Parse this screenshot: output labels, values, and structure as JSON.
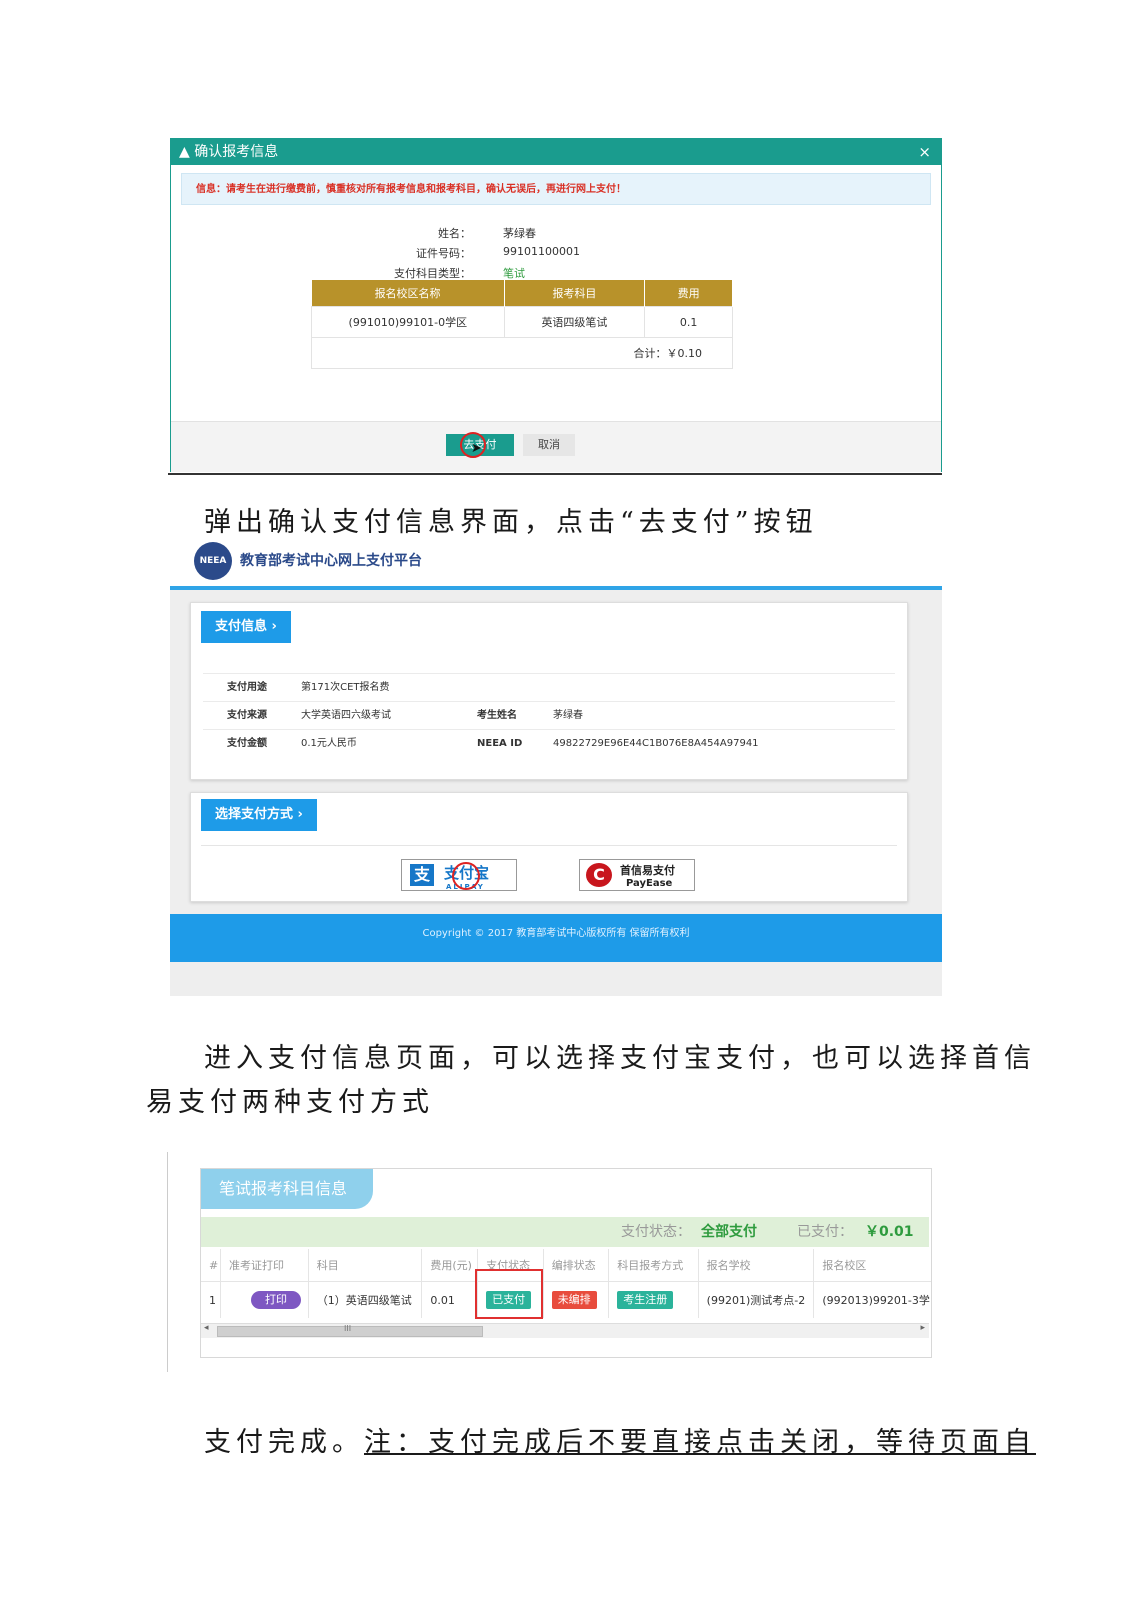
{
  "dialog": {
    "title": "确认报考信息",
    "close_icon": "×",
    "notice": "信息：请考生在进行缴费前，慎重核对所有报考信息和报考科目，确认无误后，再进行网上支付！",
    "name_label": "姓名：",
    "name_value": "茅绿春",
    "id_label": "证件号码：",
    "id_value": "99101100001",
    "type_label": "支付科目类型：",
    "type_value": "笔试",
    "table": {
      "headers": [
        "报名校区名称",
        "报考科目",
        "费用"
      ],
      "row": [
        "(991010)99101-0学区",
        "英语四级笔试",
        "0.1"
      ],
      "total": "合计：￥0.10"
    },
    "pay_button": "去支付",
    "cancel_button": "取消"
  },
  "caption1": "弹出确认支付信息界面，点击“去支付”按钮",
  "platform": {
    "logo_text": "NEEA",
    "site_name": "教育部考试中心网上支付平台",
    "section1": "支付信息 ›",
    "rows": [
      {
        "k1": "支付用途",
        "v1": "第171次CET报名费",
        "k2": "",
        "v2": ""
      },
      {
        "k1": "支付来源",
        "v1": "大学英语四六级考试",
        "k2": "考生姓名",
        "v2": "茅绿春"
      },
      {
        "k1": "支付金额",
        "v1": "0.1元人民币",
        "k2": "NEEA ID",
        "v2": "49822729E96E44C1B076E8A454A97941"
      }
    ],
    "section2": "选择支付方式 ›",
    "alipay_icon": "支",
    "alipay": "支付宝",
    "alipay_sub": "ALIPAY",
    "payease_icon": "C",
    "payease": "首信易支付",
    "payease_sub": "PayEase",
    "copyright": "Copyright © 2017 教育部考试中心版权所有 保留所有权利"
  },
  "caption2_line1": "进入支付信息页面，可以选择支付宝支付，也可以选择首信",
  "caption2_line2": "易支付两种支付方式",
  "subject": {
    "tab": "笔试报考科目信息",
    "status_label": "支付状态：",
    "status_value": "全部支付",
    "paid_label": "已支付：",
    "paid_value": "￥0.01",
    "headers": [
      "#",
      "准考证打印",
      "科目",
      "费用(元)",
      "支付状态",
      "编排状态",
      "科目报考方式",
      "报名学校",
      "报名校区"
    ],
    "row": {
      "index": "1",
      "print": "打印",
      "subject": "（1）英语四级笔试",
      "fee": "0.01",
      "pay_status": "已支付",
      "arrange_status": "未编排",
      "method": "考生注册",
      "school": "(99201)测试考点-2",
      "campus": "(992013)99201-3学"
    },
    "scroll_thumb": "III",
    "scroll_left": "◂",
    "scroll_right": "▸"
  },
  "caption3_prefix": "支付完成。",
  "caption3_note": "注：支付完成后不要直接点击关闭，等待页面自",
  "colors": {
    "teal": "#1a9c8e",
    "gold": "#b8922a",
    "blue": "#1e9be8",
    "green": "#2e9b3e",
    "red": "#e03030",
    "purple": "#7e57c2"
  }
}
